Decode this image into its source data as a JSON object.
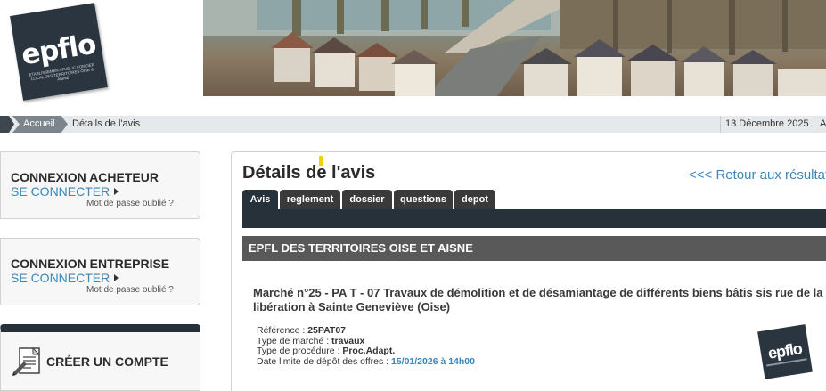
{
  "header": {
    "logo_text": "epflo",
    "logo_subtext": "ETABLISSEMENT PUBLIC FONCIER LOCAL DES TERRITOIRES OISE & AISNE"
  },
  "breadcrumb": {
    "home_label": "Accueil",
    "current": "Détails de l'avis",
    "date": "13 Décembre 2025",
    "extra": "A"
  },
  "sidebar": {
    "acheteur": {
      "title": "CONNEXION ACHETEUR",
      "connect": "SE CONNECTER",
      "forgot": "Mot de passe oublié ?"
    },
    "entreprise": {
      "title": "CONNEXION ENTREPRISE",
      "connect": "SE CONNECTER",
      "forgot": "Mot de passe oublié ?"
    },
    "compte": {
      "title": "CRÉER UN COMPTE"
    }
  },
  "main": {
    "title": "Détails de l'avis",
    "back_link": "<<< Retour aux résultats",
    "tabs": [
      {
        "label": "Avis",
        "active": true
      },
      {
        "label": "reglement",
        "active": false
      },
      {
        "label": "dossier",
        "active": false
      },
      {
        "label": "questions",
        "active": false
      },
      {
        "label": "depot",
        "active": false
      }
    ],
    "organisation": "EPFL DES TERRITOIRES OISE ET AISNE",
    "marche_title": "Marché n°25 - PA T - 07 Travaux de démolition et de désamiantage de différents biens bâtis sis rue de la libération à Sainte Geneviève (Oise)",
    "details": {
      "reference_label": "Référence : ",
      "reference_value": "25PAT07",
      "type_marche_label": "Type de marché : ",
      "type_marche_value": "travaux",
      "type_procedure_label": "Type de procédure : ",
      "type_procedure_value": "Proc.Adapt.",
      "date_limite_label": "Date limite de dépôt des offres : ",
      "date_limite_value": "15/01/2026 à 14h00"
    },
    "acheteur_logo_text": "epflo"
  },
  "colors": {
    "dark": "#27313a",
    "link": "#3a87b8",
    "org_bar": "#595959",
    "breadcrumb_bg": "#e6e9eb",
    "yellow_mark": "#f5d000"
  }
}
